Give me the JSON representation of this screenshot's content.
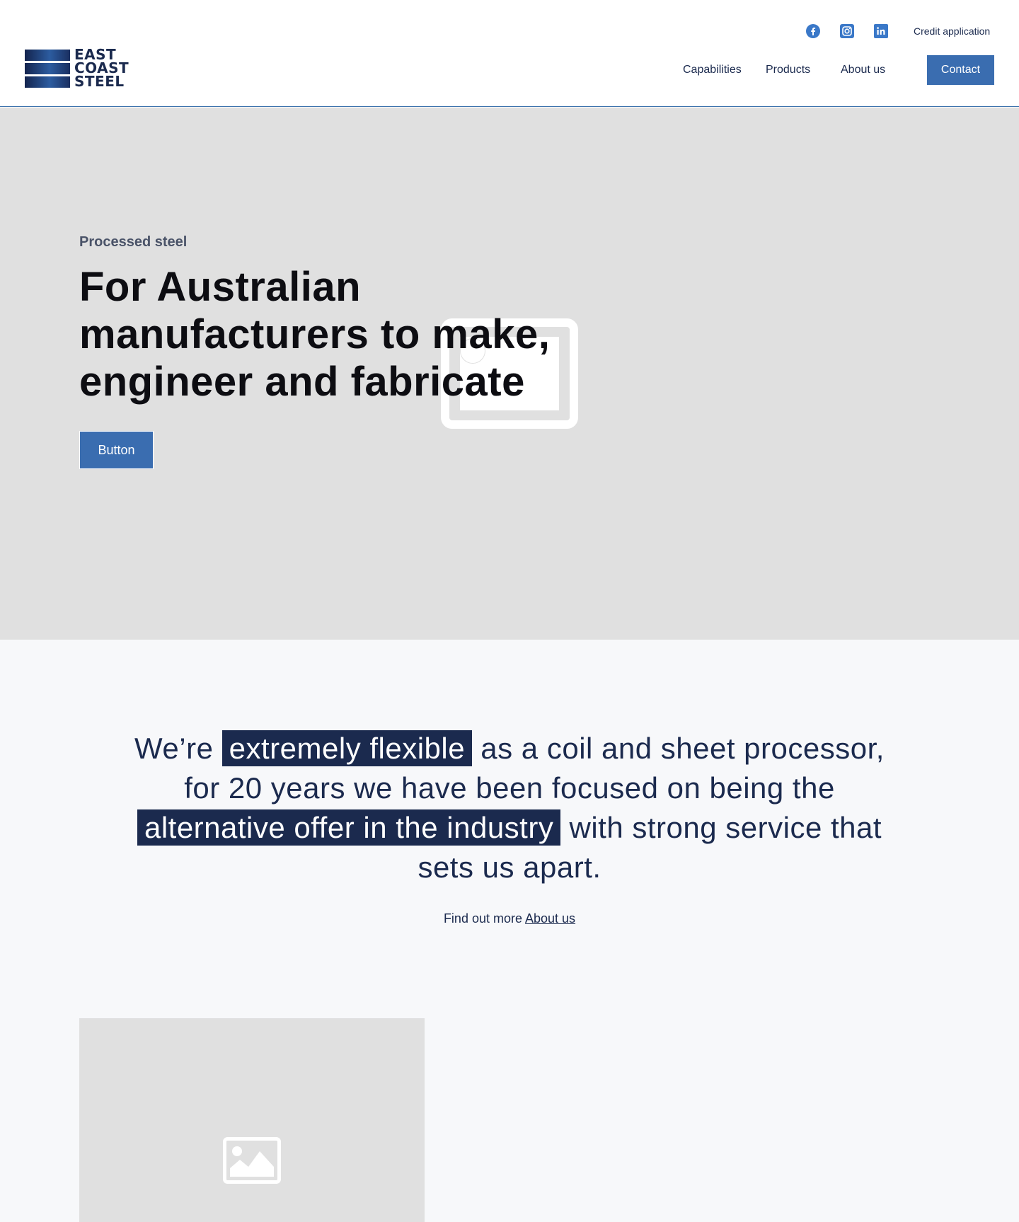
{
  "header": {
    "logo": {
      "line1": "EAST",
      "line2": "COAST",
      "line3": "STEEL"
    },
    "social": [
      {
        "name": "facebook-icon"
      },
      {
        "name": "instagram-icon"
      },
      {
        "name": "linkedin-icon"
      }
    ],
    "credit_link": "Credit application",
    "nav": [
      "Capabilities",
      "Products",
      "About us"
    ],
    "contact_label": "Contact"
  },
  "hero": {
    "eyebrow": "Processed steel",
    "title": "For Australian manufacturers to make, engineer and fabricate",
    "button_label": "Button"
  },
  "intro": {
    "part1": "We’re ",
    "highlight1": "extremely flexible",
    "part2": " as a coil and sheet processor, for 20 years we have been focused on being the ",
    "highlight2": "alternative offer in the industry",
    "part3": " with strong service that sets us apart.",
    "find_more_text": "Find out more ",
    "find_more_link": "About us"
  },
  "colors": {
    "brand": "#3a6db0",
    "navy": "#1b2a4e",
    "placeholder_bg": "#e0e0e0",
    "page_bg": "#f7f8fa"
  }
}
